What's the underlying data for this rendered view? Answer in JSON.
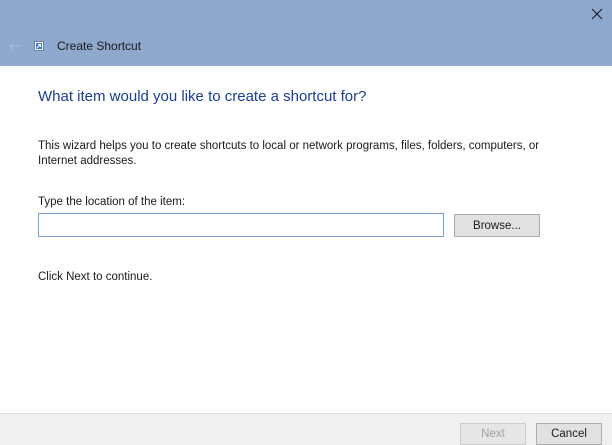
{
  "window": {
    "title": "Create Shortcut"
  },
  "main": {
    "heading": "What item would you like to create a shortcut for?",
    "description": "This wizard helps you to create shortcuts to local or network programs, files, folders, computers, or Internet addresses.",
    "location_label": "Type the location of the item:",
    "location_value": "",
    "browse_label": "Browse...",
    "continue_text": "Click Next to continue."
  },
  "footer": {
    "next_label": "Next",
    "cancel_label": "Cancel"
  },
  "icons": {
    "close": "close-icon",
    "back": "back-arrow-icon",
    "app": "shortcut-icon"
  },
  "colors": {
    "titlebar": "#8fa8cd",
    "heading": "#1a3e95",
    "input_border": "#7aa2d6"
  }
}
